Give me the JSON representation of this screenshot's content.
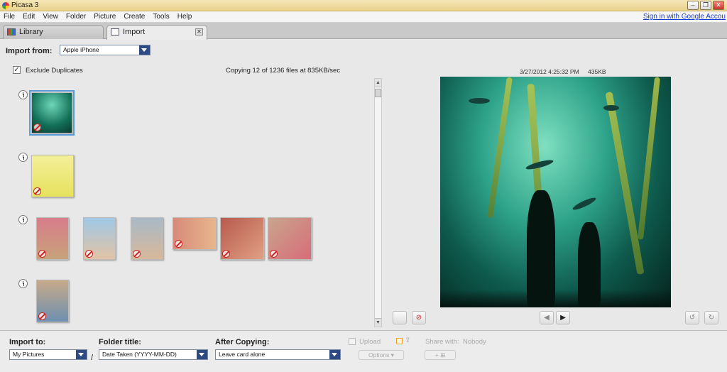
{
  "window": {
    "title": "Picasa 3",
    "minimize": "–",
    "restore": "❐",
    "close": "✕"
  },
  "menu": {
    "items": [
      "File",
      "Edit",
      "View",
      "Folder",
      "Picture",
      "Create",
      "Tools",
      "Help"
    ],
    "signin": "Sign in with Google Accou"
  },
  "tabs": [
    {
      "label": "Library",
      "icon": "library-icon"
    },
    {
      "label": "Import",
      "icon": "import-icon",
      "close": "✕"
    }
  ],
  "import_from": {
    "label": "Import from:",
    "value": "Apple iPhone"
  },
  "exclude_duplicates": {
    "label": "Exclude Duplicates",
    "checked": true,
    "mark": "✓"
  },
  "copy_status": "Copying 12 of 1236 files at 835KB/sec",
  "preview": {
    "date": "3/27/2012 4:25:32 PM",
    "size": "435KB"
  },
  "nav": {
    "prev": "◀",
    "next": "▶"
  },
  "scroll": {
    "up": "▲",
    "down": "▼"
  },
  "bottom": {
    "import_to": {
      "label": "Import to:",
      "value": "My Pictures"
    },
    "slash": "/",
    "folder_title": {
      "label": "Folder title:",
      "value": "Date Taken (YYYY-MM-DD)"
    },
    "after_copying": {
      "label": "After Copying:",
      "value": "Leave card alone"
    },
    "upload": "Upload",
    "options": "Options ▾",
    "share_with": "Share with:",
    "share_value": "Nobody",
    "add_people": "+ ⊞"
  },
  "colors": {
    "accent": "#2e4a84",
    "selection": "#5b9bd5",
    "link": "#1a3ec9"
  }
}
